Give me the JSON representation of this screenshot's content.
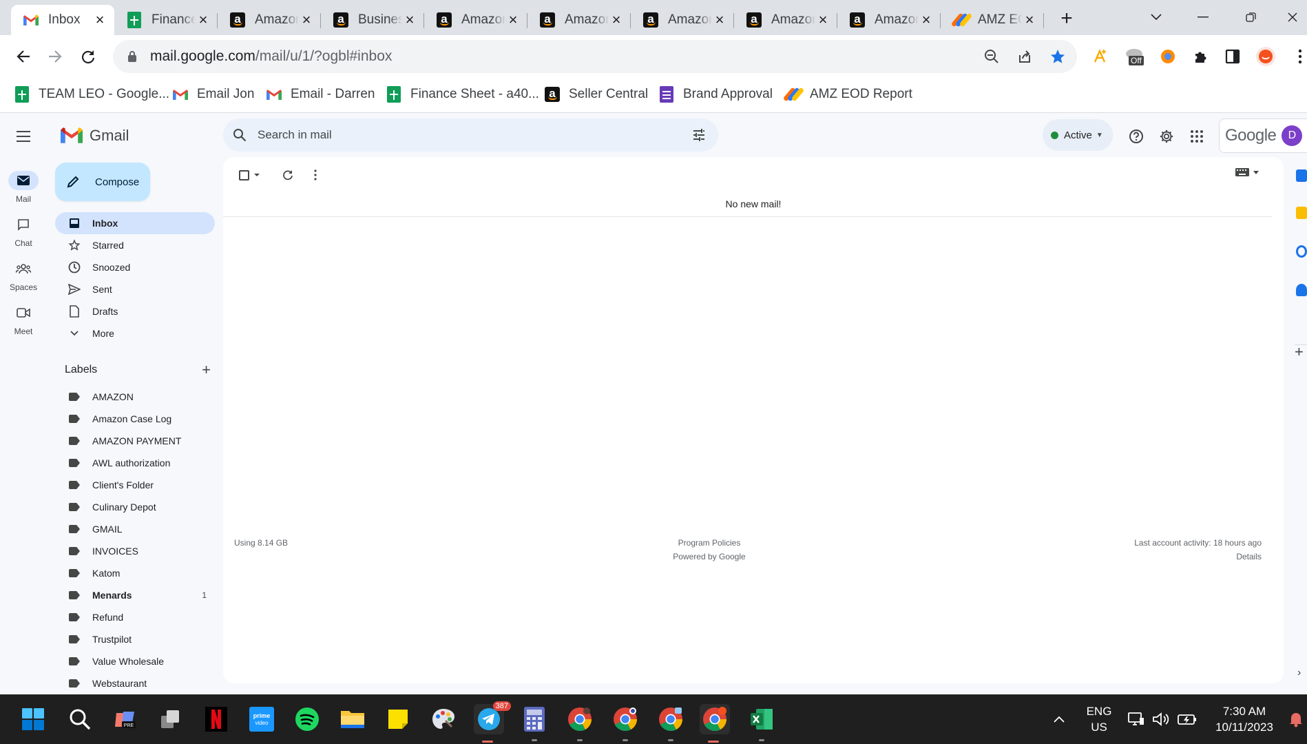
{
  "browser": {
    "tabs": [
      {
        "title": "Inbox",
        "icon": "gmail-icon",
        "active": true
      },
      {
        "title": "Finance",
        "icon": "google-sheets-icon"
      },
      {
        "title": "Amazon",
        "icon": "amazon-icon"
      },
      {
        "title": "Business",
        "icon": "amazon-icon"
      },
      {
        "title": "Amazon",
        "icon": "amazon-icon"
      },
      {
        "title": "Amazon",
        "icon": "amazon-icon"
      },
      {
        "title": "Amazon",
        "icon": "amazon-icon"
      },
      {
        "title": "Amazon",
        "icon": "amazon-icon"
      },
      {
        "title": "Amazon",
        "icon": "amazon-icon"
      },
      {
        "title": "AMZ EOD",
        "icon": "amz-eod-icon"
      }
    ],
    "url_host": "mail.google.com",
    "url_path": "/mail/u/1/?ogbl#inbox",
    "extension_badge": "Off",
    "bookmarks": [
      {
        "label": "TEAM LEO - Google...",
        "icon": "google-sheets-icon"
      },
      {
        "label": "Email Jon",
        "icon": "gmail-icon"
      },
      {
        "label": "Email - Darren",
        "icon": "gmail-icon"
      },
      {
        "label": "Finance Sheet - a40...",
        "icon": "google-sheets-icon"
      },
      {
        "label": "Seller Central",
        "icon": "amazon-icon"
      },
      {
        "label": "Brand Approval",
        "icon": "google-forms-icon"
      },
      {
        "label": "AMZ EOD Report",
        "icon": "amz-eod-icon"
      }
    ]
  },
  "gmail": {
    "product_name": "Gmail",
    "rail": [
      {
        "label": "Mail",
        "icon": "mail-icon",
        "active": true
      },
      {
        "label": "Chat",
        "icon": "chat-icon"
      },
      {
        "label": "Spaces",
        "icon": "spaces-icon"
      },
      {
        "label": "Meet",
        "icon": "meet-icon"
      }
    ],
    "search_placeholder": "Search in mail",
    "status": "Active",
    "google_word": "Google",
    "avatar_initial": "D",
    "compose_label": "Compose",
    "nav": [
      {
        "label": "Inbox",
        "icon": "inbox-icon",
        "active": true
      },
      {
        "label": "Starred",
        "icon": "star-icon"
      },
      {
        "label": "Snoozed",
        "icon": "clock-icon"
      },
      {
        "label": "Sent",
        "icon": "send-icon"
      },
      {
        "label": "Drafts",
        "icon": "draft-icon"
      },
      {
        "label": "More",
        "icon": "chevron-down-icon"
      }
    ],
    "labels_title": "Labels",
    "labels": [
      {
        "name": "AMAZON"
      },
      {
        "name": "Amazon Case Log"
      },
      {
        "name": "AMAZON PAYMENT"
      },
      {
        "name": "AWL authorization"
      },
      {
        "name": "Client's Folder"
      },
      {
        "name": "Culinary Depot"
      },
      {
        "name": "GMAIL"
      },
      {
        "name": "INVOICES"
      },
      {
        "name": "Katom"
      },
      {
        "name": "Menards",
        "count": "1",
        "bold": true
      },
      {
        "name": "Refund"
      },
      {
        "name": "Trustpilot"
      },
      {
        "name": "Value Wholesale"
      },
      {
        "name": "Webstaurant"
      }
    ],
    "empty_message": "No new mail!",
    "footer": {
      "storage": "Using 8.14 GB",
      "policies": "Program Policies",
      "powered": "Powered by Google",
      "activity": "Last account activity: 18 hours ago",
      "details": "Details"
    }
  },
  "taskbar": {
    "telegram_badge": "387",
    "lang_line1": "ENG",
    "lang_line2": "US",
    "time": "7:30 AM",
    "date": "10/11/2023"
  },
  "colors": {
    "accent_blue": "#0b57d0",
    "compose_bg": "#c2e7ff",
    "active_nav": "#d3e3fd",
    "status_green": "#1e8e3e",
    "gmail_red": "#ea4335"
  }
}
